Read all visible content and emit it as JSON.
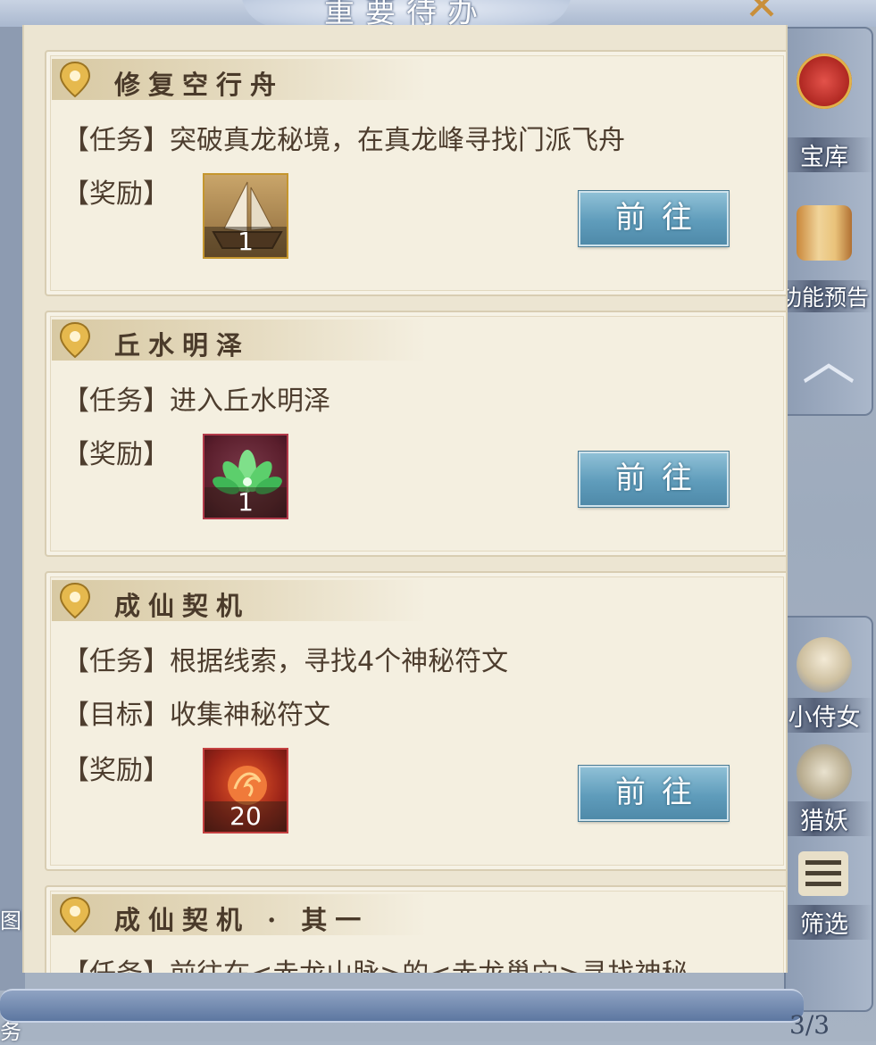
{
  "window": {
    "title": "重要待办"
  },
  "side_menu": [
    {
      "label": "宝库",
      "icon": "treasure-chest-icon"
    },
    {
      "label": "功能预告",
      "icon": "scroll-icon"
    },
    {
      "label": "小侍女",
      "icon": "maid-portrait-icon"
    },
    {
      "label": "猎妖",
      "icon": "dragon-icon"
    },
    {
      "label": "筛选",
      "icon": "filter-icon"
    }
  ],
  "left_side": {
    "label_top": "图",
    "label_bottom": "务"
  },
  "tasks": [
    {
      "title": "修复空行舟",
      "task_label": "【任务】",
      "task_text": "突破真龙秘境，在真龙峰寻找门派飞舟",
      "reward_label": "【奖励】",
      "reward_icon": "flying-boat-icon",
      "reward_qty": "1",
      "button": "前往"
    },
    {
      "title": "丘水明泽",
      "task_label": "【任务】",
      "task_text": "进入丘水明泽",
      "reward_label": "【奖励】",
      "reward_icon": "green-lotus-icon",
      "reward_qty": "1",
      "button": "前往"
    },
    {
      "title": "成仙契机",
      "task_label": "【任务】",
      "task_text": "根据线索，寻找4个神秘符文",
      "target_label": "【目标】",
      "target_text": "收集神秘符文",
      "reward_label": "【奖励】",
      "reward_icon": "fire-orb-icon",
      "reward_qty": "20",
      "button": "前往"
    },
    {
      "title": "成仙契机 · 其一",
      "task_label": "【任务】",
      "task_text": "前往在<赤龙山脉>的<赤龙巢穴>寻找神秘"
    }
  ],
  "pagination": {
    "text": "3/3"
  },
  "colors": {
    "panel_bg": "#ece5d2",
    "card_bg": "#f4efe0",
    "button_blue": "#5f9cbb",
    "text_brown": "#4d3d2e"
  }
}
